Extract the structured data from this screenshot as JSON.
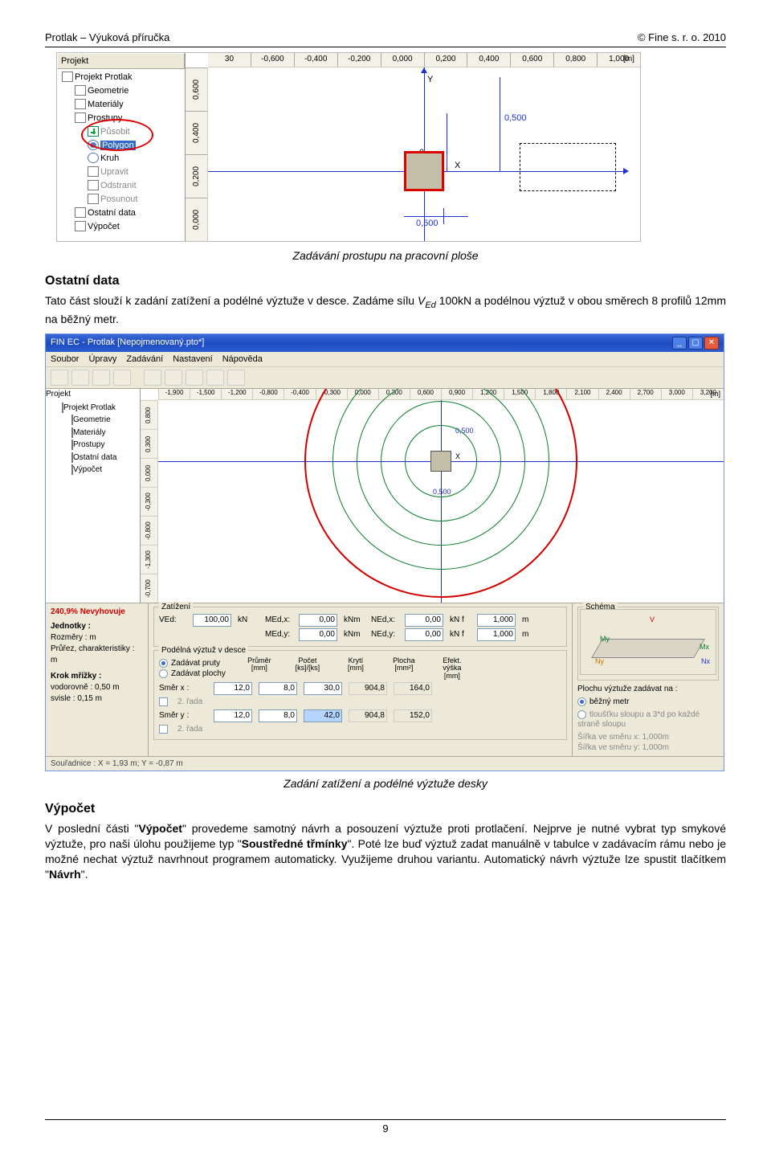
{
  "header": {
    "left": "Protlak – Výuková příručka",
    "right": "© Fine s. r. o. 2010"
  },
  "shot1": {
    "tree_header": "Projekt",
    "tree": {
      "root": "Projekt Protlak",
      "items": [
        "Geometrie",
        "Materiály",
        "Prostupy"
      ],
      "sub": {
        "add": "Působit",
        "polygon": "Polygon",
        "kruh": "Kruh",
        "upravit": "Upravit",
        "odstranit": "Odstranit",
        "posunout": "Posunout"
      },
      "items2": [
        "Ostatní data",
        "Výpočet"
      ]
    },
    "ruler_x": [
      "30",
      "-0,600",
      "-0,400",
      "-0,200",
      "0,000",
      "0,200",
      "0,400",
      "0,600",
      "0,800",
      "1,000"
    ],
    "unit_x": "[m]",
    "ruler_y": [
      "0,600",
      "0,400",
      "0,200",
      "0,000"
    ],
    "origin": "0",
    "dim1": "0,500",
    "dim2": "0,500",
    "xlabel": "X",
    "ylabel": "Y"
  },
  "cap1": "Zadávání prostupu na pracovní ploše",
  "h_ostatni": "Ostatní data",
  "p_ostatni_a": "Tato část slouží k zadání zatížení a podélné výztuže v desce. Zadáme sílu ",
  "p_ostatni_v": "V",
  "p_ostatni_sub": "Ed",
  "p_ostatni_b": " 100kN a podélnou výztuž v obou směrech 8 profilů 12mm na běžný metr.",
  "shot2": {
    "title": "FIN EC - Protlak [Nepojmenovaný.pto*]",
    "menu": [
      "Soubor",
      "Úpravy",
      "Zadávání",
      "Nastavení",
      "Nápověda"
    ],
    "tree_header": "Projekt",
    "tree": [
      "Projekt Protlak",
      "Geometrie",
      "Materiály",
      "Prostupy",
      "Ostatní data",
      "Výpočet"
    ],
    "rulerx": [
      "-1,900",
      "-1,500",
      "-1,200",
      "-0,800",
      "-0,400",
      "-0,300",
      "0,000",
      "0,300",
      "0,600",
      "0,900",
      "1,200",
      "1,500",
      "1,800",
      "2,100",
      "2,400",
      "2,700",
      "3,000",
      "3,200"
    ],
    "unit": "[m]",
    "rulery": [
      "0,800",
      "0,300",
      "0,000",
      "-0,300",
      "-0,800",
      "-1,300",
      "-0,700"
    ],
    "dim1": "0,500",
    "dim2": "0,500",
    "ax_x": "X",
    "left": {
      "status": "240,9% Nevyhovuje",
      "jednotky_h": "Jednotky :",
      "rozmery": "Rozměry : m",
      "prurez": "Průřez, charakteristiky : m",
      "krok_h": "Krok mřížky :",
      "vod": "vodorovně : 0,50 m",
      "svi": "svisle : 0,15 m"
    },
    "zat": {
      "legend": "Zatížení",
      "ved_l": "VEd:",
      "ved_v": "100,00",
      "ved_u": "kN",
      "me1_l": "MEd,x:",
      "me1_v": "0,00",
      "me1_u": "kNm",
      "ne1_l": "NEd,x:",
      "ne1_v": "0,00",
      "ne1_u": "kN f",
      "f1_v": "1,000",
      "f1_u": "m",
      "me2_l": "MEd,y:",
      "me2_v": "0,00",
      "me2_u": "kNm",
      "ne2_l": "NEd,y:",
      "ne2_v": "0,00",
      "ne2_u": "kN f",
      "f2_v": "1,000",
      "f2_u": "m"
    },
    "vyzt": {
      "legend": "Podélná výztuž v desce",
      "opt1": "Zadávat pruty",
      "opt2": "Zadávat plochy",
      "col_h": [
        "Průměr\n[mm]",
        "Počet\n[ks]/[ks]",
        "Krytí\n[mm]",
        "Plocha\n[mm²]",
        "Efekt. výška\n[mm]"
      ],
      "smerx": "Směr x :",
      "sx_vals": [
        "12,0",
        "8,0",
        "30,0",
        "904,8",
        "164,0"
      ],
      "row2x": "2. řada",
      "smery": "Směr y :",
      "sy_vals": [
        "12,0",
        "8,0",
        "42,0",
        "904,8",
        "152,0"
      ],
      "row2y": "2. řada"
    },
    "schema": {
      "legend": "Schéma",
      "V": "V",
      "Mx": "Mx",
      "My": "My",
      "Nx": "Nx",
      "Ny": "Ny",
      "ploch": "Plochu výztuže zadávat na :",
      "bezny": "běžný metr",
      "tloust": "tloušťku sloupu a 3*d po každé straně sloupu",
      "sx": "Šířka ve směru x: 1,000m",
      "sy": "Šířka ve směru y: 1,000m"
    },
    "status": "Souřadnice : X = 1,93 m; Y = -0,87 m"
  },
  "cap2": "Zadání zatížení a podélné výztuže desky",
  "h_vypocet": "Výpočet",
  "p_vyp_1a": "V poslední části \"",
  "p_vyp_1b": "Výpočet",
  "p_vyp_1c": "\" provedeme samotný návrh a posouzení výztuže proti protlačení. Nejprve je nutné vybrat typ smykové výztuže, pro naši úlohu použijeme  typ \"",
  "p_vyp_1d": "Soustředné třmínky",
  "p_vyp_1e": "\". Poté lze buď výztuž zadat manuálně v tabulce v zadávacím rámu nebo je možné nechat výztuž navrhnout programem automaticky. Využijeme druhou variantu. Automatický návrh výztuže lze spustit tlačítkem \"",
  "p_vyp_1f": "Návrh",
  "p_vyp_1g": "\".",
  "page_no": "9"
}
